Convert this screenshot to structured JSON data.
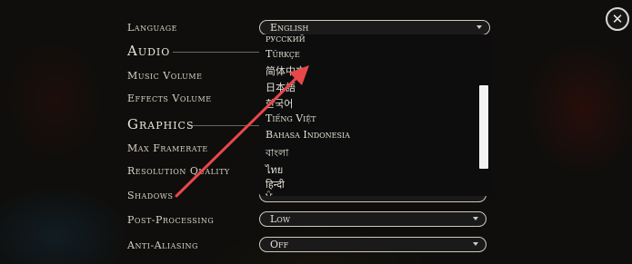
{
  "close": {
    "icon": "close-icon"
  },
  "language": {
    "label": "Language",
    "selected": "English",
    "options": [
      "русский",
      "Türkçe",
      "简体中文",
      "日本語",
      "한국어",
      "Tiếng Việt",
      "Bahasa Indonesia",
      "বাংলা",
      "ไทย",
      "हिन्दी",
      "ਪੰ"
    ]
  },
  "audio": {
    "title": "Audio",
    "music_volume_label": "Music Volume",
    "effects_volume_label": "Effects Volume"
  },
  "graphics": {
    "title": "Graphics",
    "max_framerate_label": "Max Framerate",
    "resolution_quality_label": "Resolution Quality",
    "shadows_label": "Shadows",
    "post_processing_label": "Post-Processing",
    "post_processing_value": "Low",
    "anti_aliasing_label": "Anti-Aliasing",
    "anti_aliasing_value": "Off"
  },
  "annotation": {
    "arrow_color": "#e8474a"
  }
}
